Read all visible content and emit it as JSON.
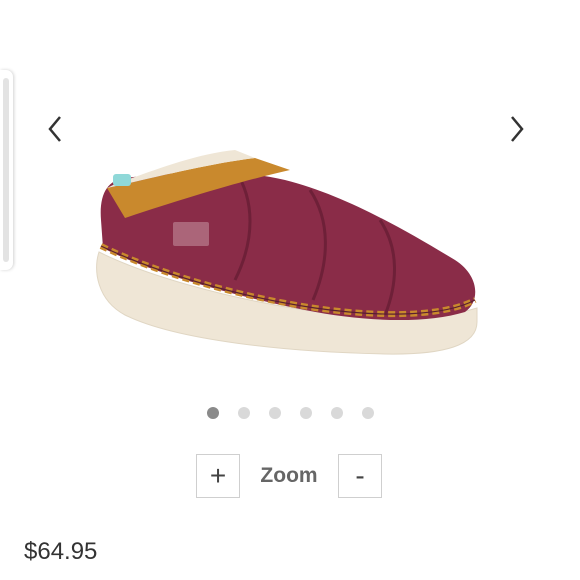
{
  "gallery": {
    "prev_icon": "chevron-left-icon",
    "next_icon": "chevron-right-icon",
    "image_count": 6,
    "active_index": 0
  },
  "zoom": {
    "plus_label": "+",
    "label": "Zoom",
    "minus_label": "-"
  },
  "product": {
    "price": "$64.95"
  },
  "colors": {
    "shoe_body": "#8a2c48",
    "shoe_trim": "#c9892d",
    "sole": "#efe6d6",
    "heel_tab": "#8fd8d8"
  }
}
